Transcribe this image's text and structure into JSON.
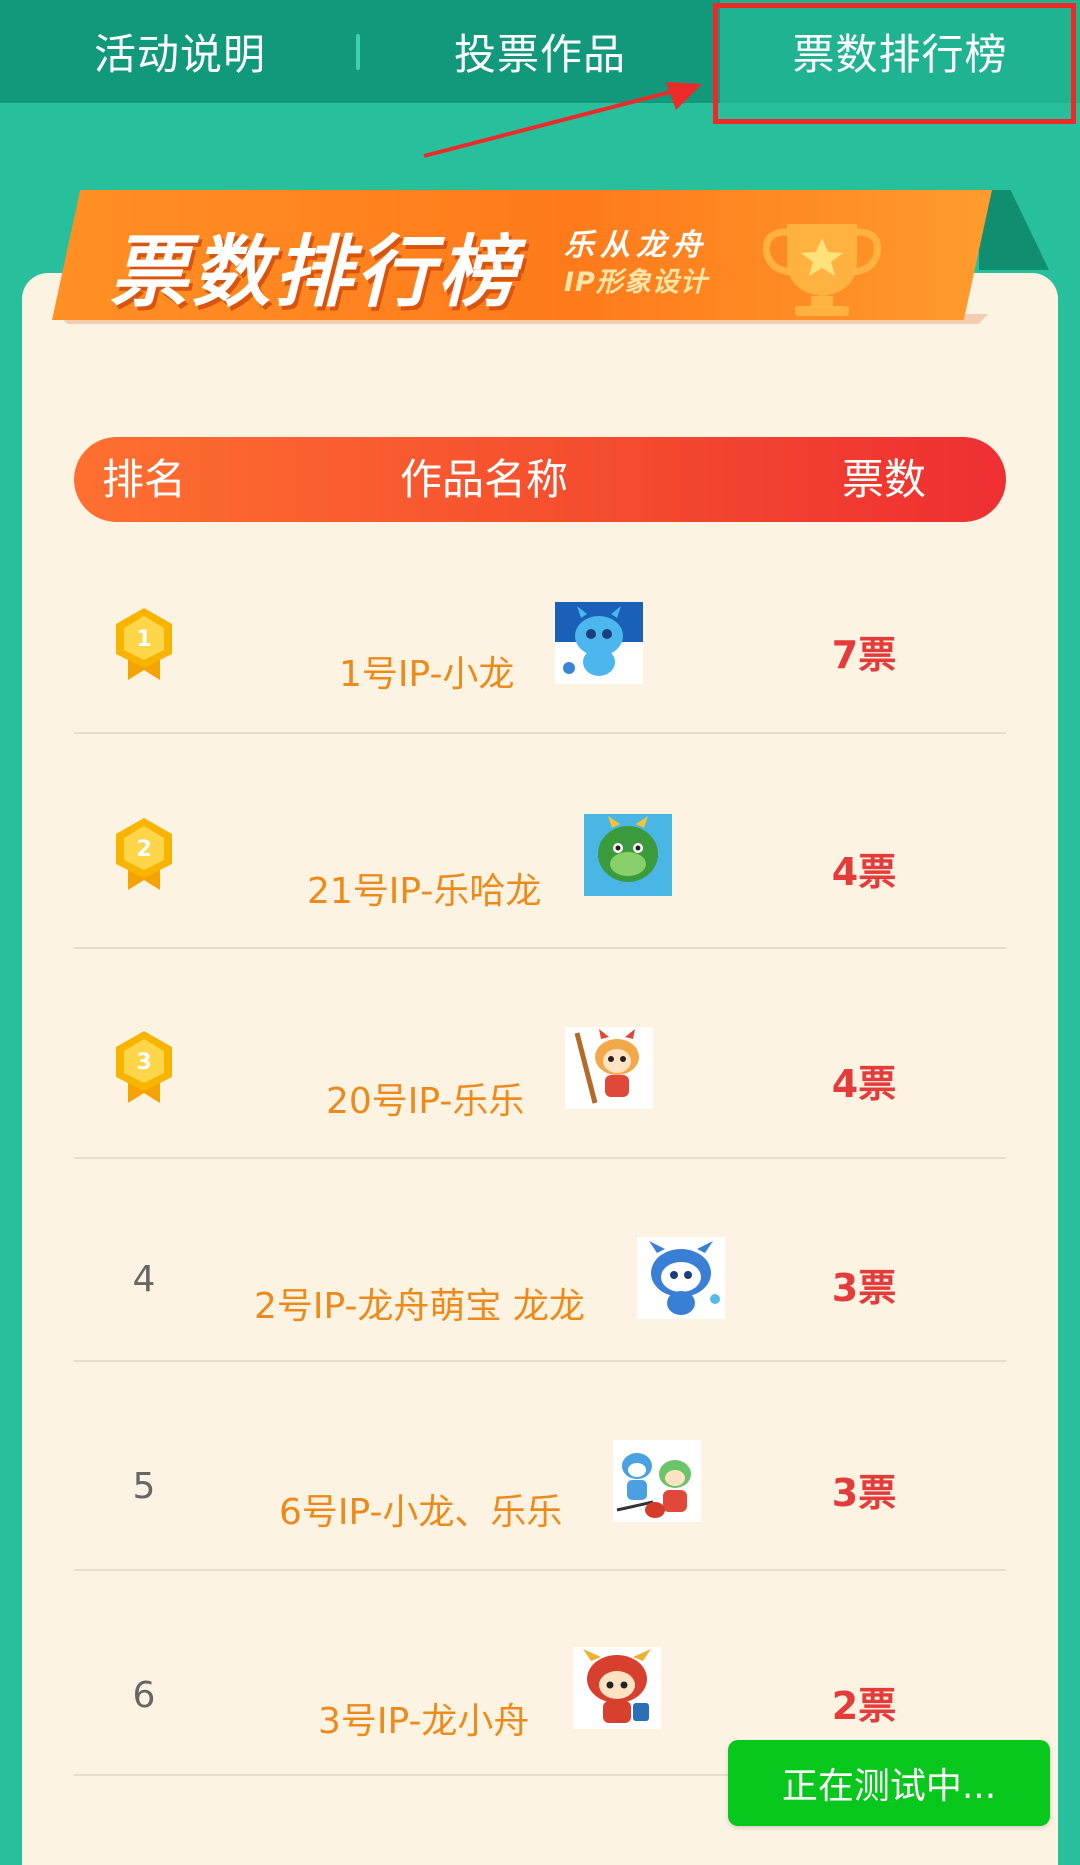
{
  "tabs": [
    {
      "label": "活动说明"
    },
    {
      "label": "投票作品"
    },
    {
      "label": "票数排行榜"
    }
  ],
  "banner": {
    "title": "票数排行榜",
    "subtitle_line1": "乐从龙舟",
    "subtitle_line2": "IP形象设计"
  },
  "table": {
    "headers": {
      "rank": "排名",
      "name": "作品名称",
      "votes": "票数"
    },
    "rows": [
      {
        "rank": "1",
        "name": "1号IP-小龙",
        "votes": "7票"
      },
      {
        "rank": "2",
        "name": "21号IP-乐哈龙",
        "votes": "4票"
      },
      {
        "rank": "3",
        "name": "20号IP-乐乐",
        "votes": "4票"
      },
      {
        "rank": "4",
        "name": "2号IP-龙舟萌宝 龙龙",
        "votes": "3票"
      },
      {
        "rank": "5",
        "name": "6号IP-小龙、乐乐",
        "votes": "3票"
      },
      {
        "rank": "6",
        "name": "3号IP-龙小舟",
        "votes": "2票"
      }
    ]
  },
  "test_button": {
    "label": "正在测试中..."
  },
  "colors": {
    "tab_bar": "#12997c",
    "background": "#27bf9c",
    "card": "#fdf3e3",
    "header_gradient_start": "#ff7030",
    "header_gradient_end": "#ee2f32",
    "name_text": "#ec8b1c",
    "votes_text": "#e43b3b",
    "test_button": "#07c61c",
    "annotation": "#ec2a2a"
  }
}
